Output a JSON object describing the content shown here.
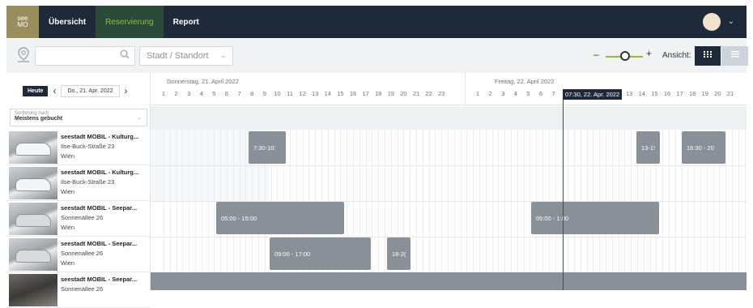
{
  "nav": {
    "logo_top": "see",
    "logo_bottom": "MO",
    "items": [
      {
        "label": "Übersicht",
        "active": false
      },
      {
        "label": "Reservierung",
        "active": true
      },
      {
        "label": "Report",
        "active": false
      }
    ],
    "user_menu_icon": "chevron-down-icon"
  },
  "toolbar": {
    "location_icon": "location-pin-icon",
    "search_value": "",
    "search_icon": "search-icon",
    "location_select": "Stadt / Standort",
    "zoom_minus": "–",
    "zoom_plus": "+",
    "view_label": "Ansicht:",
    "view_grid_icon": "grid-view-icon",
    "view_list_icon": "list-view-icon"
  },
  "datenav": {
    "today_label": "Heute",
    "prev_icon": "‹",
    "next_icon": "›",
    "date": "Do., 21. Apr. 2022"
  },
  "sort": {
    "caption": "Sortierung nach",
    "value": "Meistens gebucht"
  },
  "timeline": {
    "days": [
      {
        "label": "Donnerstag, 21. April 2022",
        "hours": [
          "1",
          "2",
          "3",
          "4",
          "5",
          "6",
          "7",
          "8",
          "9",
          "10",
          "11",
          "12",
          "13",
          "14",
          "15",
          "16",
          "17",
          "18",
          "19",
          "20",
          "21",
          "22",
          "23"
        ]
      },
      {
        "label": "Freitag, 22. April 2022",
        "hours": [
          "1",
          "2",
          "3",
          "4",
          "5",
          "6",
          "7",
          "8",
          "9",
          "10",
          "11",
          "12",
          "13",
          "14",
          "15",
          "16",
          "17",
          "18",
          "19",
          "20",
          "21"
        ]
      }
    ],
    "now_label": "07:30, 22. Apr. 2022"
  },
  "vehicles": [
    {
      "title": "seestadt MOBIL - Kulturg...",
      "street": "Ilse-Buck-Straße 23",
      "city": "Wien"
    },
    {
      "title": "seestadt MOBIL - Kulturg...",
      "street": "Ilse-Buck-Straße 23",
      "city": "Wien"
    },
    {
      "title": "seestadt MOBIL - Seepar...",
      "street": "Sonnenallee 26",
      "city": "Wien"
    },
    {
      "title": "seestadt MOBIL - Seepar...",
      "street": "Sonnenallee 26",
      "city": "Wien"
    },
    {
      "title": "seestadt MOBIL - Seepar...",
      "street": "Sonnenallee 26",
      "city": ""
    }
  ],
  "reservations": [
    {
      "label": "7:30-10:"
    },
    {
      "label": "13-1!"
    },
    {
      "label": "16:30 - 20"
    },
    {
      "label": "05:00 - 15:00"
    },
    {
      "label": "05:00 - 1:00"
    },
    {
      "label": "09:00 - 17:00"
    },
    {
      "label": "18-2("
    }
  ]
}
